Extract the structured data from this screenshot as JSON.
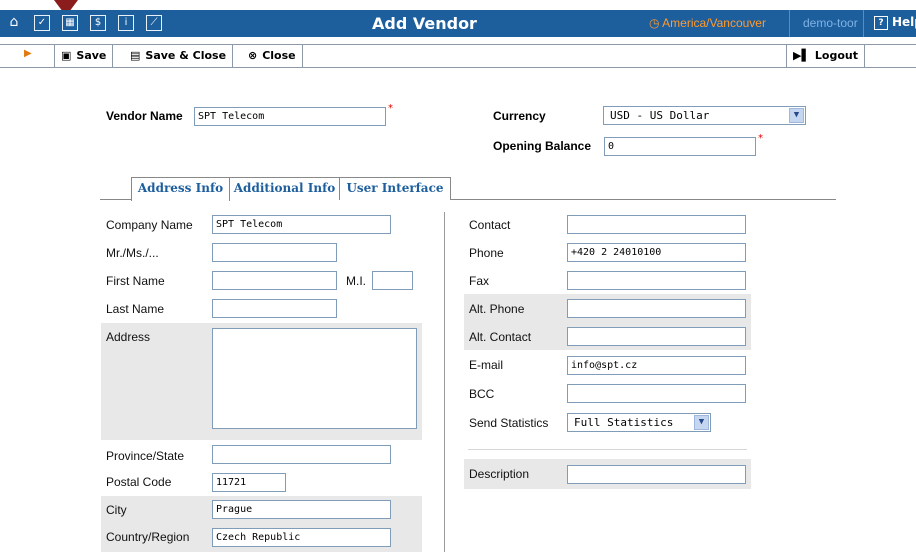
{
  "header": {
    "title": "Add Vendor",
    "timezone": "America/Vancouver",
    "user": "demo-toor",
    "help_label": "Help"
  },
  "nav_icons": [
    "home-icon",
    "checkbox-icon",
    "grid-icon",
    "dollar-icon",
    "info-icon",
    "chart-icon"
  ],
  "toolbar": {
    "save_label": "Save",
    "save_close_label": "Save & Close",
    "close_label": "Close",
    "logout_label": "Logout"
  },
  "vendor": {
    "name_label": "Vendor Name",
    "name_value": "SPT Telecom",
    "currency_label": "Currency",
    "currency_value": "USD - US Dollar",
    "opening_balance_label": "Opening Balance",
    "opening_balance_value": "0"
  },
  "tabs": [
    {
      "label": "Address Info",
      "active": true
    },
    {
      "label": "Additional Info",
      "active": false
    },
    {
      "label": "User Interface",
      "active": false
    }
  ],
  "address": {
    "company_name_label": "Company Name",
    "company_name_value": "SPT Telecom",
    "salutation_label": "Mr./Ms./...",
    "salutation_value": "",
    "first_name_label": "First Name",
    "first_name_value": "",
    "mi_label": "M.I.",
    "mi_value": "",
    "last_name_label": "Last Name",
    "last_name_value": "",
    "address_label": "Address",
    "address_value": "",
    "province_label": "Province/State",
    "province_value": "",
    "postal_code_label": "Postal Code",
    "postal_code_value": "11721",
    "city_label": "City",
    "city_value": "Prague",
    "country_label": "Country/Region",
    "country_value": "Czech Republic"
  },
  "contact": {
    "contact_label": "Contact",
    "contact_value": "",
    "phone_label": "Phone",
    "phone_value": "+420 2 24010100",
    "fax_label": "Fax",
    "fax_value": "",
    "alt_phone_label": "Alt. Phone",
    "alt_phone_value": "",
    "alt_contact_label": "Alt. Contact",
    "alt_contact_value": "",
    "email_label": "E-mail",
    "email_value": "info@spt.cz",
    "bcc_label": "BCC",
    "bcc_value": "",
    "send_stats_label": "Send Statistics",
    "send_stats_value": "Full Statistics",
    "description_label": "Description",
    "description_value": ""
  },
  "colors": {
    "nav_bar": "#1d5e9d",
    "timezone_text": "#ff9a2e",
    "tab_text": "#1d5e9d",
    "required_star": "#dd0000",
    "marker": "#8a1c1c"
  }
}
